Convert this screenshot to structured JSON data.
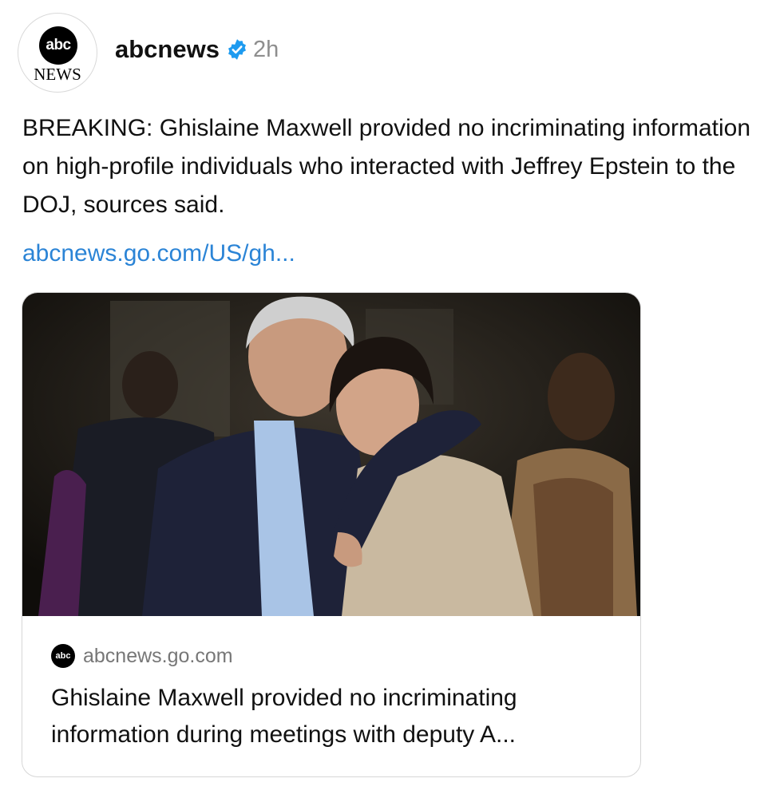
{
  "profile": {
    "avatar_top": "abc",
    "avatar_bottom": "NEWS",
    "username": "abcnews",
    "verified_icon": "verified-badge-icon",
    "verified_color": "#1d9bf0",
    "time_ago": "2h"
  },
  "post": {
    "text": "BREAKING: Ghislaine Maxwell provided no incriminating information on high-profile individuals who interacted with Jeffrey Epstein to the DOJ, sources said.",
    "link": "abcnews.go.com/US/gh..."
  },
  "link_card": {
    "image_alt": "photo-of-two-people-at-event",
    "source_logo": "abc",
    "source": "abcnews.go.com",
    "title": "Ghislaine Maxwell provided no incriminating information during meetings with deputy A..."
  }
}
